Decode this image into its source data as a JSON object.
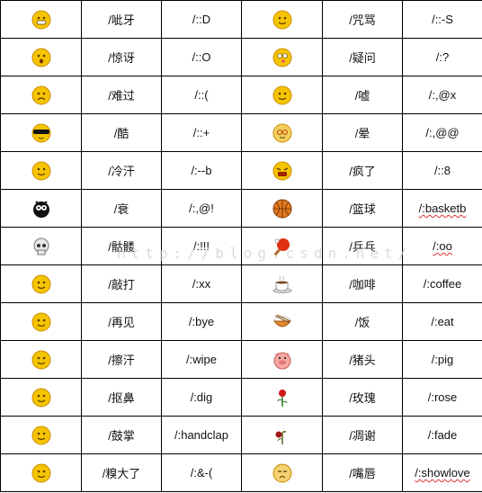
{
  "watermark": "http://blog.csdn.net/",
  "colors": {
    "face": "#f5c400",
    "face_edge": "#c98a00",
    "border": "#000000",
    "spellcheck": "#dd3333"
  },
  "rows": [
    {
      "left": {
        "icon": "grin-face-icon",
        "name": "/呲牙",
        "code": "/::D"
      },
      "right": {
        "icon": "cursing-face-icon",
        "name": "/咒骂",
        "code": "/::-S"
      }
    },
    {
      "left": {
        "icon": "surprised-face-icon",
        "name": "/惊讶",
        "code": "/::O"
      },
      "right": {
        "icon": "confused-face-icon",
        "name": "/疑问",
        "code": "/:?"
      }
    },
    {
      "left": {
        "icon": "sad-face-icon",
        "name": "/难过",
        "code": "/::("
      },
      "right": {
        "icon": "shush-face-icon",
        "name": "/嘘",
        "code": "/:,@x"
      }
    },
    {
      "left": {
        "icon": "sunglasses-face-icon",
        "name": "/酷",
        "code": "/::+"
      },
      "right": {
        "icon": "dizzy-face-icon",
        "name": "/晕",
        "code": "/:,@@"
      }
    },
    {
      "left": {
        "icon": "cold-sweat-face-icon",
        "name": "/冷汗",
        "code": "/:--b"
      },
      "right": {
        "icon": "crazy-face-icon",
        "name": "/疯了",
        "code": "/::8"
      }
    },
    {
      "left": {
        "icon": "unlucky-face-icon",
        "name": "/衰",
        "code": "/:,@!"
      },
      "right": {
        "icon": "basketball-icon",
        "name": "/篮球",
        "code": "/:basketb",
        "squiggle": true
      }
    },
    {
      "left": {
        "icon": "skull-icon",
        "name": "/骷髅",
        "code": "/:!!!"
      },
      "right": {
        "icon": "ping-pong-icon",
        "name": "/乒乓",
        "code": "/:oo",
        "squiggle": true
      }
    },
    {
      "left": {
        "icon": "knock-face-icon",
        "name": "/敲打",
        "code": "/:xx"
      },
      "right": {
        "icon": "coffee-icon",
        "name": "/咖啡",
        "code": "/:coffee"
      }
    },
    {
      "left": {
        "icon": "bye-face-icon",
        "name": "/再见",
        "code": "/:bye"
      },
      "right": {
        "icon": "rice-bowl-icon",
        "name": "/饭",
        "code": "/:eat"
      }
    },
    {
      "left": {
        "icon": "wipe-sweat-face-icon",
        "name": "/擦汗",
        "code": "/:wipe"
      },
      "right": {
        "icon": "pig-icon",
        "name": "/猪头",
        "code": "/:pig"
      }
    },
    {
      "left": {
        "icon": "pick-nose-face-icon",
        "name": "/抠鼻",
        "code": "/:dig"
      },
      "right": {
        "icon": "rose-icon",
        "name": "/玫瑰",
        "code": "/:rose"
      }
    },
    {
      "left": {
        "icon": "clap-face-icon",
        "name": "/鼓掌",
        "code": "/:handclap"
      },
      "right": {
        "icon": "faded-rose-icon",
        "name": "/凋谢",
        "code": "/:fade"
      }
    },
    {
      "left": {
        "icon": "embarrassed-face-icon",
        "name": "/糗大了",
        "code": "/:&-("
      },
      "right": {
        "icon": "pout-face-icon",
        "name": "/嘴唇",
        "code": "/:showlove",
        "squiggle": true
      }
    }
  ]
}
